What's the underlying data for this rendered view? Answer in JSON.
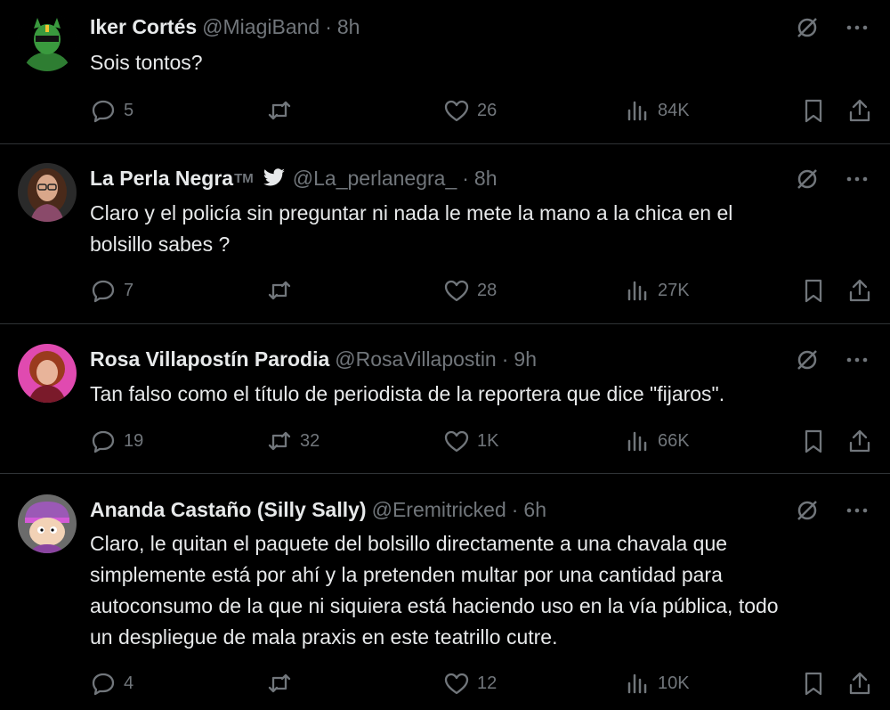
{
  "tweets": [
    {
      "name": "Iker Cortés",
      "tm": "",
      "verified_bird": false,
      "handle": "@MiagiBand",
      "time": "8h",
      "lines": [
        "Sois tontos?"
      ],
      "replies": "5",
      "retweets": "",
      "likes": "26",
      "views": "84K",
      "avatar": "green-masked-character"
    },
    {
      "name": "La Perla Negra",
      "tm": "TM",
      "verified_bird": true,
      "handle": "@La_perlanegra_",
      "time": "8h",
      "lines": [
        "Claro y el policía sin preguntar ni nada le mete la mano a la chica en el",
        "bolsillo sabes ?"
      ],
      "replies": "7",
      "retweets": "",
      "likes": "28",
      "views": "27K",
      "avatar": "woman-with-glasses"
    },
    {
      "name": "Rosa Villapostín Parodia",
      "tm": "",
      "verified_bird": false,
      "handle": "@RosaVillapostin",
      "time": "9h",
      "lines": [
        "Tan falso como el título de periodista de la reportera que dice \"fijaros\"."
      ],
      "replies": "19",
      "retweets": "32",
      "likes": "1K",
      "views": "66K",
      "avatar": "woman-red-hair"
    },
    {
      "name": "Ananda Castaño (Silly Sally)",
      "tm": "",
      "verified_bird": false,
      "handle": "@Eremitricked",
      "time": "6h",
      "lines": [
        "Claro, le quitan el paquete del bolsillo directamente a una chavala que",
        "simplemente está por ahí y la pretenden multar por una cantidad para",
        "autoconsumo de la que ni siquiera está haciendo uso en la vía pública, todo",
        "un despliegue de mala praxis en este teatrillo cutre."
      ],
      "replies": "4",
      "retweets": "",
      "likes": "12",
      "views": "10K",
      "avatar": "cartoon-character-purple-hat"
    }
  ],
  "colors": {
    "background": "#000000",
    "text": "#e7e9ea",
    "muted": "#71767b",
    "divider": "#2f3336",
    "bird": "#1d9bf0"
  }
}
